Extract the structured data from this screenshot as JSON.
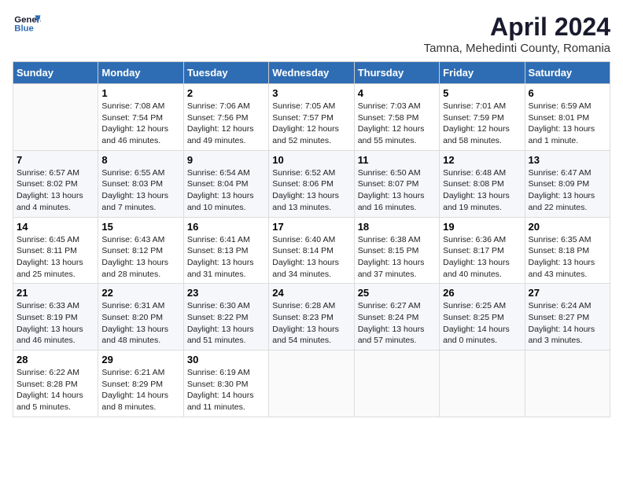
{
  "header": {
    "logo_line1": "General",
    "logo_line2": "Blue",
    "month_title": "April 2024",
    "subtitle": "Tamna, Mehedinti County, Romania"
  },
  "weekdays": [
    "Sunday",
    "Monday",
    "Tuesday",
    "Wednesday",
    "Thursday",
    "Friday",
    "Saturday"
  ],
  "weeks": [
    [
      {
        "day": "",
        "info": ""
      },
      {
        "day": "1",
        "info": "Sunrise: 7:08 AM\nSunset: 7:54 PM\nDaylight: 12 hours\nand 46 minutes."
      },
      {
        "day": "2",
        "info": "Sunrise: 7:06 AM\nSunset: 7:56 PM\nDaylight: 12 hours\nand 49 minutes."
      },
      {
        "day": "3",
        "info": "Sunrise: 7:05 AM\nSunset: 7:57 PM\nDaylight: 12 hours\nand 52 minutes."
      },
      {
        "day": "4",
        "info": "Sunrise: 7:03 AM\nSunset: 7:58 PM\nDaylight: 12 hours\nand 55 minutes."
      },
      {
        "day": "5",
        "info": "Sunrise: 7:01 AM\nSunset: 7:59 PM\nDaylight: 12 hours\nand 58 minutes."
      },
      {
        "day": "6",
        "info": "Sunrise: 6:59 AM\nSunset: 8:01 PM\nDaylight: 13 hours\nand 1 minute."
      }
    ],
    [
      {
        "day": "7",
        "info": "Sunrise: 6:57 AM\nSunset: 8:02 PM\nDaylight: 13 hours\nand 4 minutes."
      },
      {
        "day": "8",
        "info": "Sunrise: 6:55 AM\nSunset: 8:03 PM\nDaylight: 13 hours\nand 7 minutes."
      },
      {
        "day": "9",
        "info": "Sunrise: 6:54 AM\nSunset: 8:04 PM\nDaylight: 13 hours\nand 10 minutes."
      },
      {
        "day": "10",
        "info": "Sunrise: 6:52 AM\nSunset: 8:06 PM\nDaylight: 13 hours\nand 13 minutes."
      },
      {
        "day": "11",
        "info": "Sunrise: 6:50 AM\nSunset: 8:07 PM\nDaylight: 13 hours\nand 16 minutes."
      },
      {
        "day": "12",
        "info": "Sunrise: 6:48 AM\nSunset: 8:08 PM\nDaylight: 13 hours\nand 19 minutes."
      },
      {
        "day": "13",
        "info": "Sunrise: 6:47 AM\nSunset: 8:09 PM\nDaylight: 13 hours\nand 22 minutes."
      }
    ],
    [
      {
        "day": "14",
        "info": "Sunrise: 6:45 AM\nSunset: 8:11 PM\nDaylight: 13 hours\nand 25 minutes."
      },
      {
        "day": "15",
        "info": "Sunrise: 6:43 AM\nSunset: 8:12 PM\nDaylight: 13 hours\nand 28 minutes."
      },
      {
        "day": "16",
        "info": "Sunrise: 6:41 AM\nSunset: 8:13 PM\nDaylight: 13 hours\nand 31 minutes."
      },
      {
        "day": "17",
        "info": "Sunrise: 6:40 AM\nSunset: 8:14 PM\nDaylight: 13 hours\nand 34 minutes."
      },
      {
        "day": "18",
        "info": "Sunrise: 6:38 AM\nSunset: 8:15 PM\nDaylight: 13 hours\nand 37 minutes."
      },
      {
        "day": "19",
        "info": "Sunrise: 6:36 AM\nSunset: 8:17 PM\nDaylight: 13 hours\nand 40 minutes."
      },
      {
        "day": "20",
        "info": "Sunrise: 6:35 AM\nSunset: 8:18 PM\nDaylight: 13 hours\nand 43 minutes."
      }
    ],
    [
      {
        "day": "21",
        "info": "Sunrise: 6:33 AM\nSunset: 8:19 PM\nDaylight: 13 hours\nand 46 minutes."
      },
      {
        "day": "22",
        "info": "Sunrise: 6:31 AM\nSunset: 8:20 PM\nDaylight: 13 hours\nand 48 minutes."
      },
      {
        "day": "23",
        "info": "Sunrise: 6:30 AM\nSunset: 8:22 PM\nDaylight: 13 hours\nand 51 minutes."
      },
      {
        "day": "24",
        "info": "Sunrise: 6:28 AM\nSunset: 8:23 PM\nDaylight: 13 hours\nand 54 minutes."
      },
      {
        "day": "25",
        "info": "Sunrise: 6:27 AM\nSunset: 8:24 PM\nDaylight: 13 hours\nand 57 minutes."
      },
      {
        "day": "26",
        "info": "Sunrise: 6:25 AM\nSunset: 8:25 PM\nDaylight: 14 hours\nand 0 minutes."
      },
      {
        "day": "27",
        "info": "Sunrise: 6:24 AM\nSunset: 8:27 PM\nDaylight: 14 hours\nand 3 minutes."
      }
    ],
    [
      {
        "day": "28",
        "info": "Sunrise: 6:22 AM\nSunset: 8:28 PM\nDaylight: 14 hours\nand 5 minutes."
      },
      {
        "day": "29",
        "info": "Sunrise: 6:21 AM\nSunset: 8:29 PM\nDaylight: 14 hours\nand 8 minutes."
      },
      {
        "day": "30",
        "info": "Sunrise: 6:19 AM\nSunset: 8:30 PM\nDaylight: 14 hours\nand 11 minutes."
      },
      {
        "day": "",
        "info": ""
      },
      {
        "day": "",
        "info": ""
      },
      {
        "day": "",
        "info": ""
      },
      {
        "day": "",
        "info": ""
      }
    ]
  ]
}
